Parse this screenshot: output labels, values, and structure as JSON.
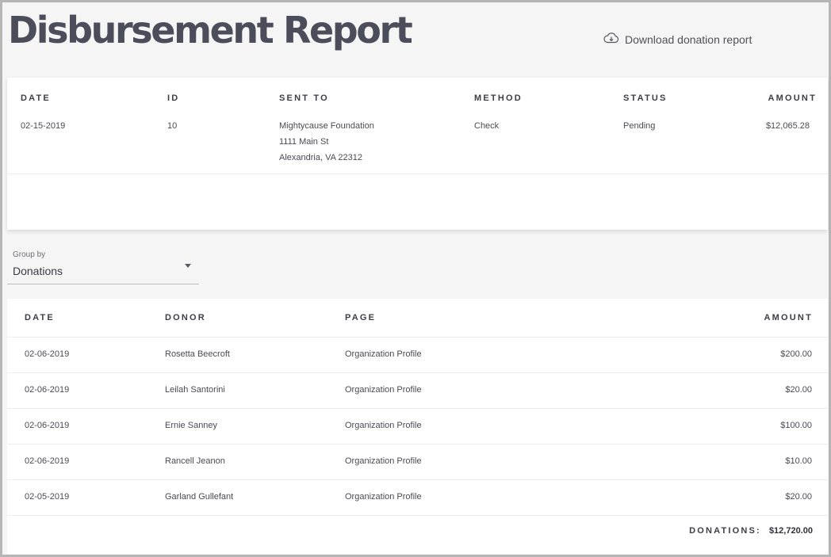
{
  "page": {
    "title": "Disbursement Report",
    "download_label": "Download donation report",
    "download_icon": "cloud-download-icon"
  },
  "disbursement": {
    "headers": {
      "date": "DATE",
      "id": "ID",
      "sent_to": "SENT TO",
      "method": "METHOD",
      "status": "STATUS",
      "amount": "AMOUNT"
    },
    "row": {
      "date": "02-15-2019",
      "id": "10",
      "sent_to_name": "Mightycause Foundation",
      "sent_to_street": "1111 Main St",
      "sent_to_city": "Alexandria, VA 22312",
      "method": "Check",
      "status": "Pending",
      "amount": "$12,065.28"
    }
  },
  "group_by": {
    "label": "Group by",
    "value": "Donations"
  },
  "donations": {
    "headers": {
      "date": "DATE",
      "donor": "DONOR",
      "page": "PAGE",
      "amount": "AMOUNT"
    },
    "rows": [
      {
        "date": "02-06-2019",
        "donor": "Rosetta Beecroft",
        "page": "Organization Profile",
        "amount": "$200.00"
      },
      {
        "date": "02-06-2019",
        "donor": "Leilah Santorini",
        "page": "Organization Profile",
        "amount": "$20.00"
      },
      {
        "date": "02-06-2019",
        "donor": "Ernie Sanney",
        "page": "Organization Profile",
        "amount": "$100.00"
      },
      {
        "date": "02-06-2019",
        "donor": "Rancell Jeanon",
        "page": "Organization Profile",
        "amount": "$10.00"
      },
      {
        "date": "02-05-2019",
        "donor": "Garland Gullefant",
        "page": "Organization Profile",
        "amount": "$20.00"
      }
    ],
    "total_label": "DONATIONS:",
    "total_value": "$12,720.00"
  }
}
